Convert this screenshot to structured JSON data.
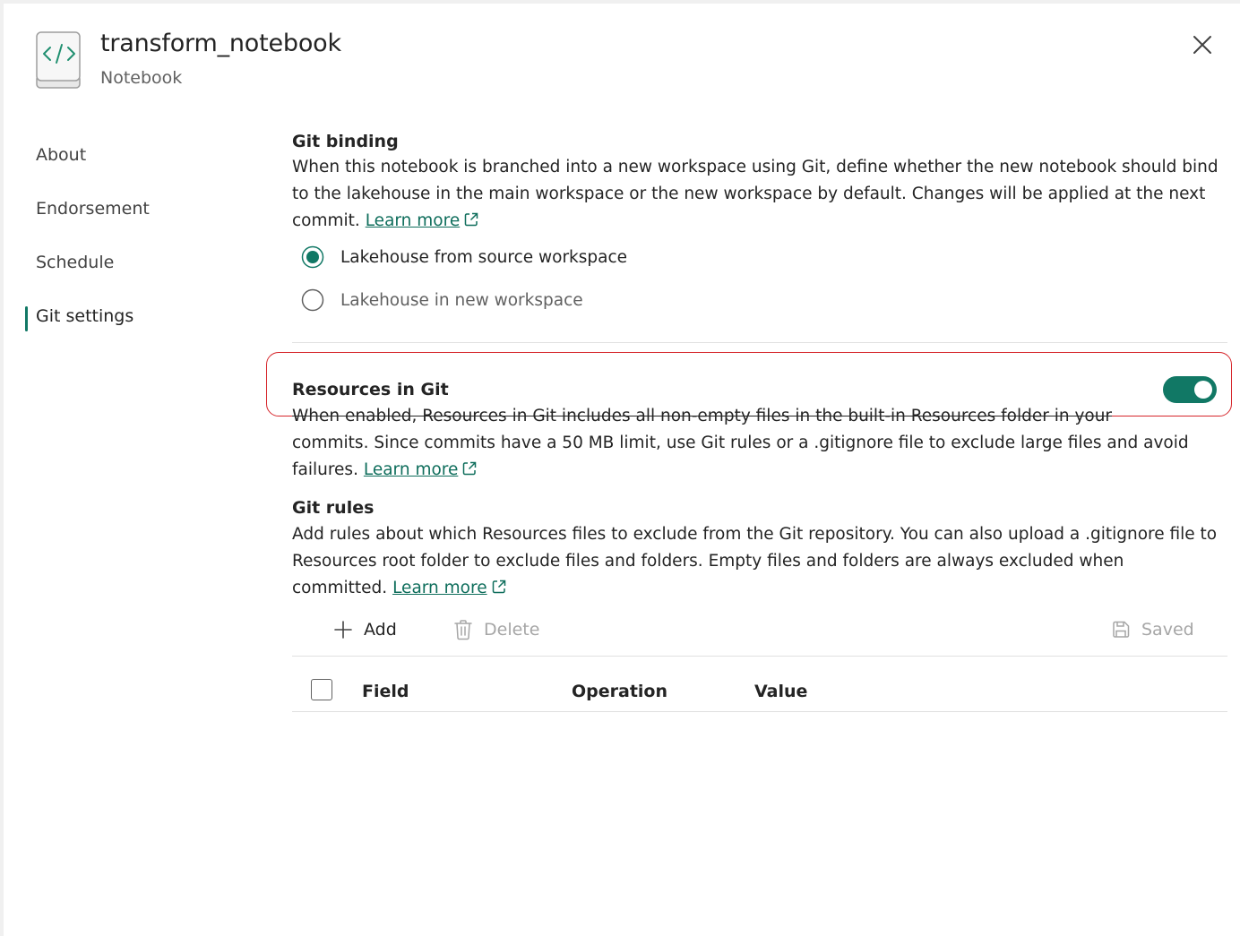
{
  "header": {
    "title": "transform_notebook",
    "subtitle": "Notebook",
    "icon": "notebook-code-icon"
  },
  "nav": {
    "items": [
      {
        "label": "About"
      },
      {
        "label": "Endorsement"
      },
      {
        "label": "Schedule"
      },
      {
        "label": "Git settings",
        "active": true
      }
    ]
  },
  "git_binding": {
    "title": "Git binding",
    "description": "When this notebook is branched into a new workspace using Git, define whether the new notebook should bind to the lakehouse in the main workspace or the new workspace by default. Changes will be applied at the next commit.",
    "learn_more": "Learn more",
    "options": [
      {
        "label": "Lakehouse from source workspace",
        "selected": true
      },
      {
        "label": "Lakehouse in new workspace",
        "selected": false
      }
    ]
  },
  "resources": {
    "title": "Resources in Git",
    "enabled": true,
    "desc_line1": "When enabled, Resources in Git includes all non-empty files in the built-in Resources folder in your",
    "desc_rest": "commits. Since commits have a 50 MB limit, use Git rules or a .gitignore file to exclude large files and avoid failures.",
    "learn_more": "Learn more"
  },
  "git_rules": {
    "title": "Git rules",
    "description": "Add rules about which Resources files to exclude from the Git repository. You can also upload a .gitignore file to Resources root folder to exclude files and folders. Empty files and folders are always excluded when committed.",
    "learn_more": "Learn more"
  },
  "toolbar": {
    "add_label": "Add",
    "delete_label": "Delete",
    "saved_label": "Saved"
  },
  "table": {
    "columns": [
      "Field",
      "Operation",
      "Value"
    ]
  },
  "colors": {
    "accent": "#117865",
    "link": "#0f6e5c",
    "highlight": "#d6262b"
  }
}
